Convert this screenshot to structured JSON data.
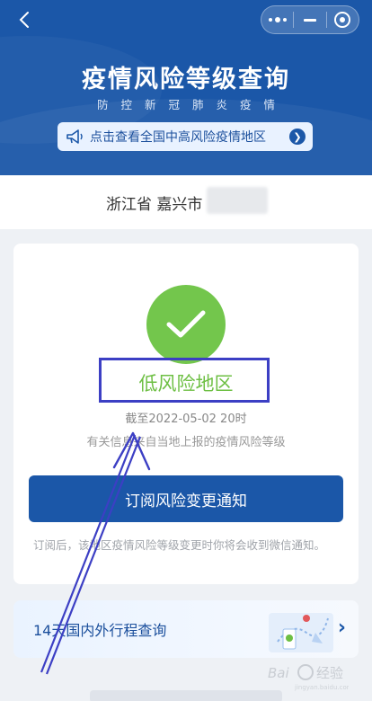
{
  "header": {
    "title": "疫情风险等级查询",
    "subtitle": "防控新冠肺炎疫情",
    "notice": "点击查看全国中高风险疫情地区"
  },
  "location": {
    "region": "浙江省 嘉兴市"
  },
  "status": {
    "level": "低风险地区",
    "as_of": "截至2022-05-02 20时",
    "note": "有关信息来自当地上报的疫情风险等级",
    "level_color": "#6dbf43"
  },
  "subscribe": {
    "button_label": "订阅风险变更通知",
    "note": "订阅后，该地区疫情风险等级变更时你将会收到微信通知。"
  },
  "trip": {
    "label": "14天国内外行程查询"
  },
  "colors": {
    "brand": "#1b57a8",
    "success": "#73c64c",
    "annotation": "#3c3fc4"
  }
}
